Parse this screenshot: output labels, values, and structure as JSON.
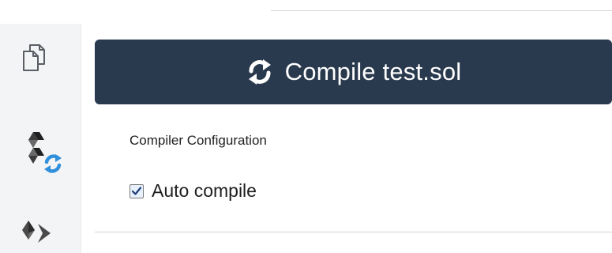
{
  "sidebar": {
    "icons": [
      {
        "name": "file-explorer-icon"
      },
      {
        "name": "solidity-compiler-icon"
      },
      {
        "name": "deploy-run-icon"
      }
    ]
  },
  "compiler": {
    "compile_button_label": "Compile test.sol",
    "section_title": "Compiler Configuration",
    "auto_compile_label": "Auto compile",
    "auto_compile_checked": true
  },
  "colors": {
    "button_bg": "#2a3a4e",
    "rail_bg": "#f3f4f6",
    "accent_blue": "#2f8fdb"
  }
}
